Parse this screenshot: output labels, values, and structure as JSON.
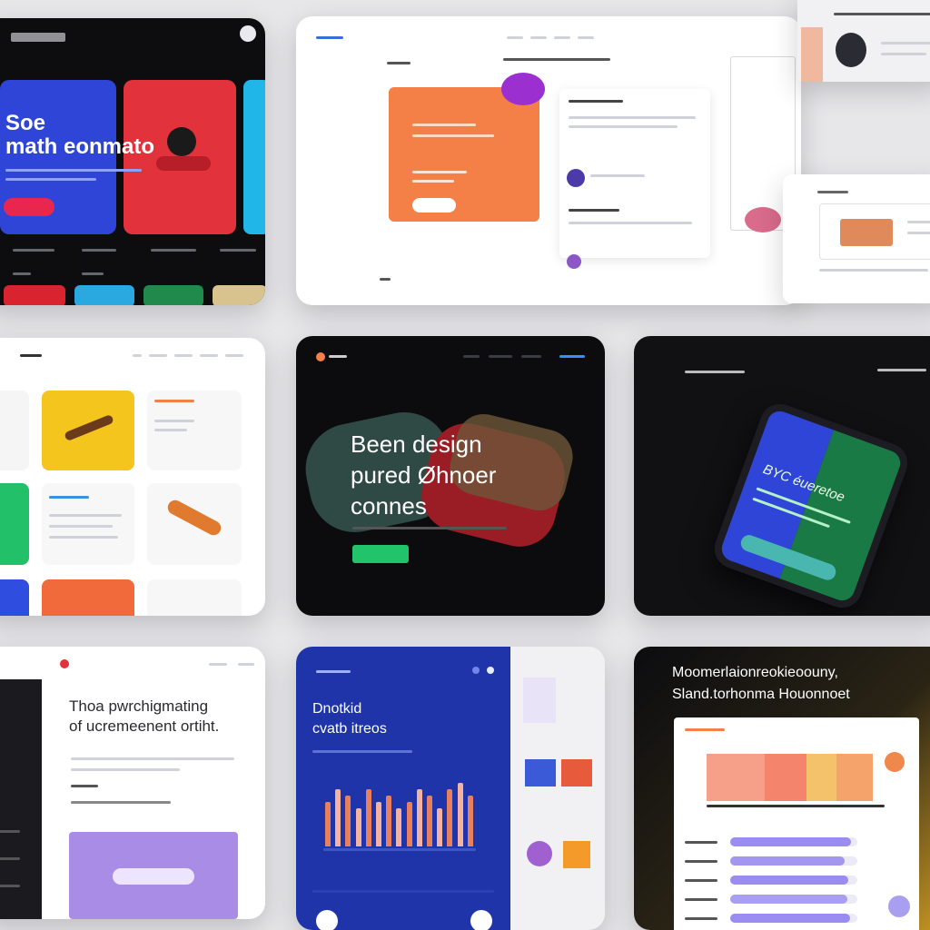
{
  "hero_dark_red": {
    "headline_line1": "Soe",
    "headline_line2": "math eonmato"
  },
  "dark_landing": {
    "headline_line1": "Been design",
    "headline_line2": "pured Øhnoer",
    "headline_line3": "connes"
  },
  "phone_mockup": {
    "screen_text": "BYC éueretoe"
  },
  "article_page": {
    "title_line1": "Thoa pwrchigmating",
    "title_line2": "of ucremeenent ortiht."
  },
  "blue_dashboard": {
    "title_line1": "Dnotkid",
    "title_line2": "cvatb itreos",
    "bar_values": [
      7,
      9,
      8,
      6,
      9,
      7,
      8,
      6,
      7,
      9,
      8,
      6,
      9,
      10,
      8
    ],
    "bar_color_a": "#e8805e",
    "bar_color_b": "#f4b3a0"
  },
  "night_analytics": {
    "headline_line1": "Moomerlaionreokieoouny,",
    "headline_line2": "Sland.torhonma Houonnoet",
    "stacked_segments": [
      {
        "value": 35,
        "color": "#f6a089"
      },
      {
        "value": 25,
        "color": "#f4846c"
      },
      {
        "value": 18,
        "color": "#f3c26a"
      },
      {
        "value": 22,
        "color": "#f5a36a"
      }
    ],
    "progress_rows": [
      {
        "fraction": 0.95,
        "color": "#9a8cf0"
      },
      {
        "fraction": 0.9,
        "color": "#a296ef"
      },
      {
        "fraction": 0.93,
        "color": "#9a8cf0"
      },
      {
        "fraction": 0.92,
        "color": "#a99ff1"
      },
      {
        "fraction": 0.94,
        "color": "#9a8cf0"
      }
    ]
  },
  "colors": {
    "accent_blue": "#2f45d8",
    "accent_red": "#e2323b",
    "accent_orange": "#f48048",
    "accent_green": "#22c46b",
    "dashboard_blue": "#1e34a8"
  }
}
